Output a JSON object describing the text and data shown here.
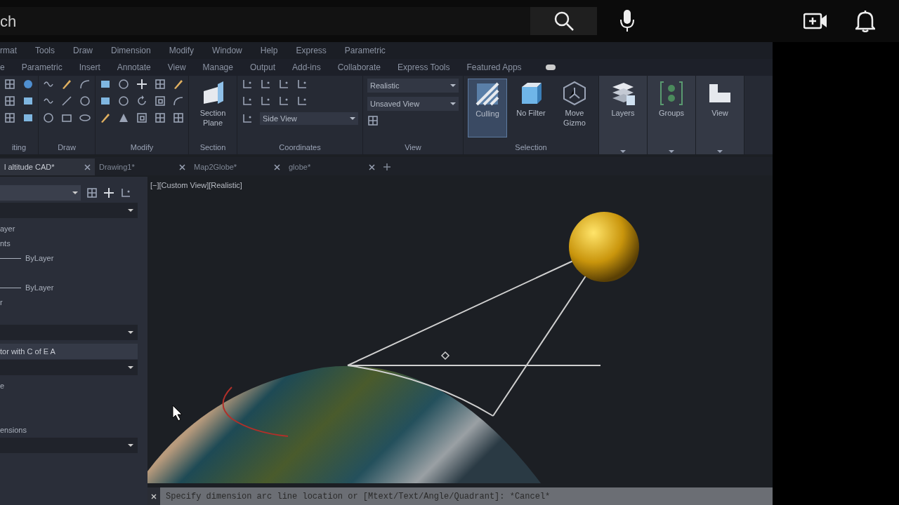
{
  "top_bar": {
    "search_text": "ch"
  },
  "menu_bar": [
    "rmat",
    "Tools",
    "Draw",
    "Dimension",
    "Modify",
    "Window",
    "Help",
    "Express",
    "Parametric"
  ],
  "ribbon_tabs": [
    "e",
    "Parametric",
    "Insert",
    "Annotate",
    "View",
    "Manage",
    "Output",
    "Add-ins",
    "Collaborate",
    "Express Tools",
    "Featured Apps"
  ],
  "ribbon_panels": [
    {
      "kind": "tools",
      "label": "iting"
    },
    {
      "kind": "tools",
      "label": "Draw"
    },
    {
      "kind": "tools",
      "label": "Modify"
    },
    {
      "kind": "big",
      "label": "Section",
      "buttons": [
        {
          "label": "Section Plane",
          "selected": false
        }
      ]
    },
    {
      "kind": "tools",
      "label": "Coordinates",
      "dropdown": "Side View"
    },
    {
      "kind": "dropdowns",
      "label": "View",
      "dropdowns": [
        "Realistic",
        "Unsaved View"
      ]
    },
    {
      "kind": "big",
      "label": "Selection",
      "buttons": [
        {
          "label": "Culling",
          "selected": true
        },
        {
          "label": "No Filter",
          "selected": false
        },
        {
          "label": "Move Gizmo",
          "selected": false
        }
      ]
    },
    {
      "kind": "big",
      "buttons": [
        {
          "label": "Layers",
          "selected": false
        }
      ]
    },
    {
      "kind": "big",
      "buttons": [
        {
          "label": "Groups",
          "selected": false
        }
      ]
    },
    {
      "kind": "big",
      "buttons": [
        {
          "label": "View",
          "selected": false
        }
      ]
    }
  ],
  "document_tabs": [
    {
      "label": "l altitude CAD*",
      "selected": true
    },
    {
      "label": "Drawing1*",
      "selected": false
    },
    {
      "label": "Map2Globe*",
      "selected": false
    },
    {
      "label": "globe*",
      "selected": false
    }
  ],
  "viewport": {
    "label": "[−][Custom View][Realistic]"
  },
  "properties_palette": [
    {
      "kind": "header"
    },
    {
      "kind": "dropdown"
    },
    {
      "kind": "text",
      "text": "ayer"
    },
    {
      "kind": "text",
      "text": "nts"
    },
    {
      "kind": "linetype",
      "text": "ByLayer"
    },
    {
      "kind": "blank"
    },
    {
      "kind": "linetype",
      "text": "ByLayer"
    },
    {
      "kind": "text",
      "text": "r"
    },
    {
      "kind": "blank"
    },
    {
      "kind": "dropdown"
    },
    {
      "kind": "highlight",
      "text": "tor with C of E A"
    },
    {
      "kind": "dropdown"
    },
    {
      "kind": "text",
      "text": "e"
    },
    {
      "kind": "blank"
    },
    {
      "kind": "blank"
    },
    {
      "kind": "text",
      "text": "ensions"
    },
    {
      "kind": "dropdown"
    }
  ],
  "command_line": {
    "text": "Specify dimension arc line location or [Mtext/Text/Angle/Quadrant]: *Cancel*"
  }
}
